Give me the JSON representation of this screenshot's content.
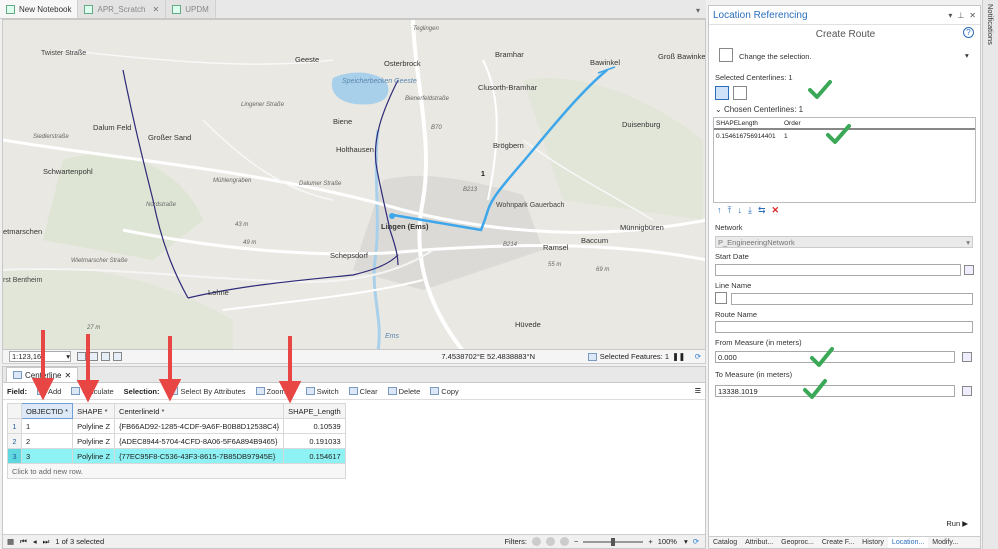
{
  "doc_tabs": [
    {
      "label": "New Notebook",
      "active": true
    },
    {
      "label": "APR_Scratch",
      "active": false
    },
    {
      "label": "UPDM",
      "active": false
    }
  ],
  "map": {
    "labels": {
      "twister": "Twister Straße",
      "geeste": "Geeste",
      "osterbrock": "Osterbrock",
      "bramhar": "Bramhar",
      "bawinkel": "Bawinkel",
      "gross_bawinkel": "Groß Bawinke",
      "speicherbecken": "Speicherbecken Geeste",
      "clusorth": "Clusorth-Bramhar",
      "dalum_feld": "Dalum Feld",
      "grosser_sand": "Großer Sand",
      "biene": "Biene",
      "b70": "B70",
      "duisenburg": "Duisenburg",
      "siedlerstrasse": "Siedlerstraße",
      "holthausen": "Holthausen",
      "brogbern": "Brögbern",
      "schwartenpohl": "Schwartenpohl",
      "muehlengraben": "Mühlengraben",
      "b213": "B213",
      "route_number": "1",
      "wohnpark": "Wohnpark Gauerbach",
      "nordstrasse": "Nordstraße",
      "lingen": "Lingen (Ems)",
      "muennigbueren": "Münnigbüren",
      "etmarschen": "etmarschen",
      "ramsel": "Ramsel",
      "baccum": "Baccum",
      "b214": "B214",
      "schepsdorf": "Schepsdorf",
      "lohne": "Lohne",
      "bentheim": "rst Bentheim",
      "huevede": "Hüvede",
      "m43": "43 m",
      "m49": "49 m",
      "m55": "55 m",
      "m69": "69 m",
      "m27": "27 m",
      "ems": "Ems",
      "wietmarscher": "Wietmarscher Straße",
      "daluemer": "Dalumer Straße",
      "lingener": "Lingener Straße",
      "bienerfeld": "Bienerfeldstraße",
      "teglingen": "Teglingen"
    }
  },
  "map_status": {
    "scale": "1:123,168",
    "coordinates": "7.4538702°E 52.4838883°N",
    "selected_features": "Selected Features: 1"
  },
  "attribute_table": {
    "tab_label": "Centerline",
    "toolbar": {
      "field_label": "Field:",
      "add_label": "Add",
      "calculate_label": "Calculate",
      "selection_label": "Selection:",
      "select_by_attributes": "Select By Attributes",
      "zoom_to": "Zoom To",
      "switch": "Switch",
      "clear": "Clear",
      "delete": "Delete",
      "copy": "Copy"
    },
    "columns": [
      "OBJECTID *",
      "SHAPE *",
      "CenterlineId *",
      "SHAPE_Length"
    ],
    "rows": [
      {
        "n": "1",
        "objectid": "1",
        "shape": "Polyline Z",
        "centerline_id": "{FB66AD92-1285-4CDF-9A6F-B0B8D12538C4}",
        "length": "0.10539"
      },
      {
        "n": "2",
        "objectid": "2",
        "shape": "Polyline Z",
        "centerline_id": "{ADEC8944-5704-4CFD-8A06-5F6A894B9465}",
        "length": "0.191033"
      },
      {
        "n": "3",
        "objectid": "3",
        "shape": "Polyline Z",
        "centerline_id": "{77EC95F8-C536-43F3-8615-7B85DB97945E}",
        "length": "0.154617"
      }
    ],
    "add_row_text": "Click to add new row.",
    "status": {
      "count": "1 of 3 selected",
      "filters_label": "Filters:",
      "zoom": "100%"
    }
  },
  "location_referencing": {
    "pane_title": "Location Referencing",
    "tool_title": "Create Route",
    "change_selection": "Change the selection.",
    "selected_centerlines": "Selected Centerlines: 1",
    "chosen_centerlines": "Chosen Centerlines: 1",
    "cl_headers": [
      "SHAPELength",
      "Order"
    ],
    "cl_rows": [
      {
        "length": "0.154616756914401",
        "order": "1"
      }
    ],
    "network_label": "Network",
    "network_value": "P_EngineeringNetwork",
    "start_date_label": "Start Date",
    "line_name_label": "Line Name",
    "route_name_label": "Route Name",
    "from_measure_label": "From Measure (in meters)",
    "from_measure_value": "0.000",
    "to_measure_label": "To Measure (in meters)",
    "to_measure_value": "13338.1019",
    "run_label": "Run ▶",
    "bottom_tabs": [
      "Catalog",
      "Attribut...",
      "Geoproc...",
      "Create F...",
      "History",
      "Location...",
      "Modify..."
    ]
  },
  "notifications_label": "Notifications",
  "colors": {
    "route_blue": "#3ea6ea",
    "centerline_navy": "#2d2a78",
    "accent": "#2a6ebb",
    "selected_row": "#8ef2f4",
    "annotation_red": "#e84545",
    "check_green": "#3aa856"
  }
}
